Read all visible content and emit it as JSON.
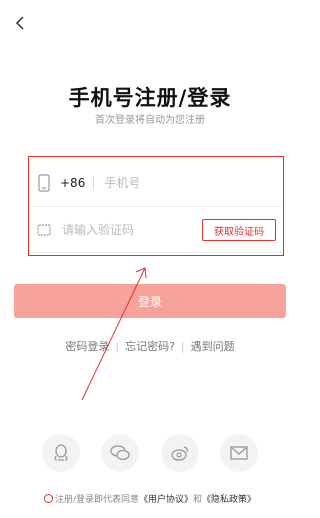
{
  "header": {
    "back_icon": "chevron-left-icon"
  },
  "title": "手机号注册/登录",
  "subtitle": "首次登录将自动为您注册",
  "phone": {
    "country_code": "+86",
    "placeholder": "手机号",
    "icon": "phone-icon"
  },
  "code": {
    "placeholder": "请输入验证码",
    "icon": "message-icon",
    "get_code_label": "获取验证码"
  },
  "login_label": "登录",
  "links": {
    "password_login": "密码登录",
    "forgot_password": "忘记密码?",
    "problem": "遇到问题"
  },
  "socials": [
    {
      "name": "qq-icon"
    },
    {
      "name": "wechat-icon"
    },
    {
      "name": "weibo-icon"
    },
    {
      "name": "mail-icon"
    }
  ],
  "agreement": {
    "prefix": "注册/登录即代表同意",
    "user_agreement": "《用户协议》",
    "and": "和",
    "privacy_policy": "《隐私政策》"
  },
  "colors": {
    "accent": "#e0302b",
    "login_button": "#f7a29b"
  }
}
